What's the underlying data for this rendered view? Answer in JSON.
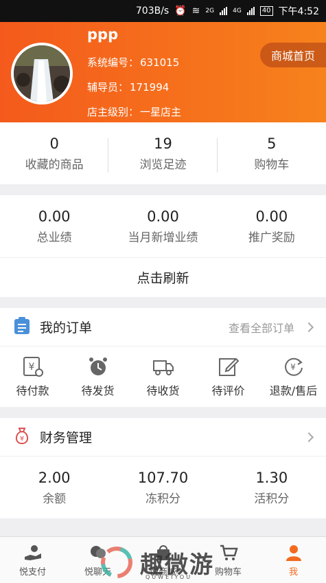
{
  "status_bar": {
    "speed": "703B/s",
    "net2g": "2G",
    "net4g": "4G",
    "battery": "40",
    "time": "下午4:52"
  },
  "profile": {
    "username": "ppp",
    "system_no_label": "系统编号：",
    "system_no": "631015",
    "mentor_label": "辅导员：",
    "mentor": "171994",
    "level_label": "店主级别：",
    "level": "一星店主",
    "store_home_label": "商城首页"
  },
  "stats": [
    {
      "value": "0",
      "label": "收藏的商品"
    },
    {
      "value": "19",
      "label": "浏览足迹"
    },
    {
      "value": "5",
      "label": "购物车"
    }
  ],
  "performance": [
    {
      "value": "0.00",
      "label": "总业绩"
    },
    {
      "value": "0.00",
      "label": "当月新增业绩"
    },
    {
      "value": "0.00",
      "label": "推广奖励"
    }
  ],
  "refresh_label": "点击刷新",
  "orders": {
    "title": "我的订单",
    "view_all": "查看全部订单",
    "items": [
      {
        "label": "待付款",
        "icon": "yen-bill-icon"
      },
      {
        "label": "待发货",
        "icon": "alarm-clock-icon"
      },
      {
        "label": "待收货",
        "icon": "truck-icon"
      },
      {
        "label": "待评价",
        "icon": "pencil-edit-icon"
      },
      {
        "label": "退款/售后",
        "icon": "refund-icon"
      }
    ]
  },
  "finance": {
    "title": "财务管理",
    "items": [
      {
        "value": "2.00",
        "label": "余额"
      },
      {
        "value": "107.70",
        "label": "冻积分"
      },
      {
        "value": "1.30",
        "label": "活积分"
      }
    ]
  },
  "tabs": [
    {
      "label": "悦支付"
    },
    {
      "label": "悦聊天"
    },
    {
      "label": "悦商城"
    },
    {
      "label": "购物车"
    },
    {
      "label": "我"
    }
  ],
  "watermark": {
    "text": "趣微游",
    "sub": "QUWEIYOU"
  },
  "colors": {
    "accent": "#f36a1e",
    "header_start": "#f45a1c",
    "header_end": "#f7821c",
    "order_icon": "#4a90d9",
    "finance_icon": "#e05050"
  }
}
